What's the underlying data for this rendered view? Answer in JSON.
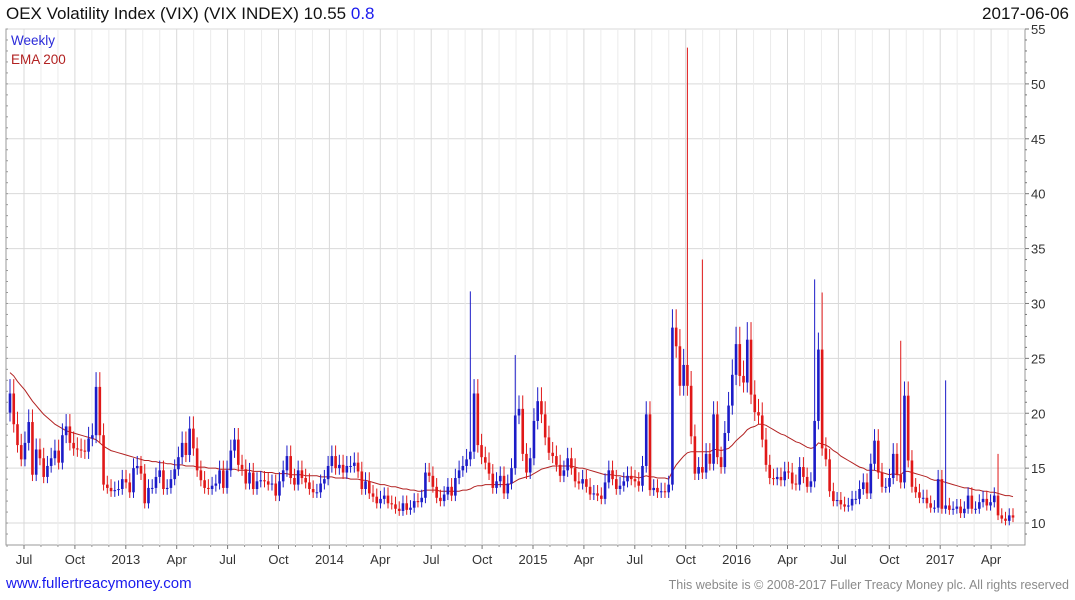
{
  "header": {
    "title": "OEX Volatility Index (VIX) (VIX INDEX) 10.55",
    "change": "0.8",
    "date": "2017-06-06"
  },
  "footer": {
    "link": "www.fullertreacymoney.com",
    "copyright": "This website is © 2008-2017 Fuller Treacy Money plc. All rights reserved"
  },
  "legend": [
    {
      "label": "Weekly",
      "color": "#2b2bd9"
    },
    {
      "label": "EMA 200",
      "color": "#b22222"
    }
  ],
  "colors": {
    "up": "#1c1cc8",
    "down": "#e01818",
    "ema": "#b22222",
    "grid": "#d9d9d9"
  },
  "chart_data": {
    "type": "candlestick",
    "title": "OEX Volatility Index (VIX) (VIX INDEX)",
    "frequency": "Weekly",
    "ylim": [
      8,
      55
    ],
    "yticks": [
      10,
      15,
      20,
      25,
      30,
      35,
      40,
      45,
      50,
      55
    ],
    "x_tick_labels": [
      "Jul",
      "Oct",
      "2013",
      "Apr",
      "Jul",
      "Oct",
      "2014",
      "Apr",
      "Jul",
      "Oct",
      "2015",
      "Apr",
      "Jul",
      "Oct",
      "2016",
      "Apr",
      "Jul",
      "Oct",
      "2017",
      "Apr"
    ],
    "grid": true,
    "legend_position": "top-left",
    "close": [
      21.8,
      19.0,
      17.1,
      15.8,
      17.3,
      19.2,
      14.4,
      16.7,
      15.9,
      14.2,
      15.2,
      15.9,
      16.6,
      15.5,
      18.0,
      18.8,
      17.3,
      16.8,
      16.7,
      16.6,
      16.5,
      17.7,
      18.0,
      22.4,
      18.0,
      13.5,
      13.2,
      12.9,
      13.0,
      13.1,
      14.0,
      13.7,
      12.8,
      15.0,
      15.2,
      14.5,
      11.8,
      13.2,
      13.2,
      14.2,
      14.8,
      13.1,
      13.2,
      14.0,
      14.9,
      16.0,
      17.3,
      16.2,
      18.6,
      16.8,
      14.8,
      13.9,
      13.2,
      13.1,
      13.4,
      13.6,
      14.8,
      13.2,
      14.8,
      16.6,
      17.6,
      15.3,
      14.9,
      13.6,
      14.6,
      13.1,
      13.8,
      13.9,
      13.8,
      13.5,
      13.6,
      12.5,
      13.8,
      14.8,
      16.1,
      14.1,
      13.5,
      14.8,
      14.1,
      13.7,
      13.1,
      12.8,
      12.8,
      13.6,
      14.0,
      15.2,
      16.1,
      15.0,
      15.3,
      14.6,
      15.2,
      15.2,
      15.5,
      14.7,
      13.1,
      13.8,
      12.7,
      12.4,
      11.8,
      12.2,
      12.5,
      11.8,
      11.7,
      11.3,
      11.1,
      11.8,
      11.2,
      11.4,
      12.0,
      11.9,
      12.3,
      14.6,
      14.3,
      13.3,
      12.3,
      12.0,
      12.6,
      13.3,
      12.5,
      14.1,
      14.8,
      15.2,
      15.8,
      16.5,
      21.8,
      17.1,
      16.0,
      15.5,
      14.5,
      13.2,
      13.8,
      14.3,
      12.7,
      13.6,
      15.0,
      19.8,
      20.4,
      16.3,
      14.6,
      15.9,
      19.3,
      21.1,
      19.9,
      17.8,
      16.4,
      16.1,
      15.3,
      14.3,
      14.8,
      15.9,
      15.0,
      13.8,
      13.6,
      14.0,
      13.3,
      12.6,
      12.7,
      12.5,
      12.2,
      13.7,
      14.8,
      14.0,
      13.1,
      13.4,
      13.8,
      14.3,
      14.0,
      13.8,
      13.4,
      15.2,
      19.9,
      13.0,
      13.2,
      12.8,
      12.9,
      12.8,
      13.5,
      27.8,
      26.1,
      22.5,
      24.4,
      22.5,
      17.9,
      14.5,
      15.1,
      14.6,
      16.3,
      15.4,
      19.9,
      16.0,
      15.1,
      18.2,
      20.7,
      23.5,
      26.3,
      23.4,
      22.8,
      26.7,
      21.7,
      20.1,
      19.8,
      17.6,
      15.3,
      14.1,
      14.0,
      14.2,
      13.9,
      14.7,
      14.6,
      13.6,
      13.5,
      15.1,
      14.2,
      13.3,
      13.8,
      19.3,
      25.8,
      16.8,
      15.8,
      12.9,
      12.0,
      12.1,
      11.7,
      11.5,
      11.6,
      12.2,
      12.2,
      13.1,
      13.7,
      12.7,
      15.4,
      17.5,
      14.6,
      13.3,
      13.3,
      14.1,
      16.3,
      14.4,
      13.7,
      21.6,
      15.7,
      13.3,
      12.8,
      12.3,
      12.3,
      11.8,
      11.4,
      11.4,
      14.0,
      11.3,
      11.6,
      11.2,
      11.3,
      11.5,
      10.9,
      11.3,
      12.5,
      11.3,
      11.3,
      11.9,
      12.2,
      11.6,
      11.9,
      12.5,
      10.7,
      10.4,
      10.2,
      10.7,
      10.5
    ],
    "ema_200": [
      23.7,
      23.4,
      22.9,
      22.5,
      22.1,
      21.6,
      21.1,
      20.7,
      20.3,
      19.9,
      19.6,
      19.3,
      19.0,
      18.8,
      18.6,
      18.4,
      18.3,
      18.2,
      18.1,
      18.0,
      17.9,
      17.8,
      17.7,
      17.6,
      17.3,
      17.0,
      16.8,
      16.6,
      16.5,
      16.4,
      16.3,
      16.2,
      16.1,
      16.0,
      15.9,
      15.8,
      15.7,
      15.7,
      15.6,
      15.6,
      15.5,
      15.5,
      15.4,
      15.4,
      15.3,
      15.3,
      15.3,
      15.2,
      15.2,
      15.2,
      15.1,
      15.1,
      15.1,
      15.0,
      15.0,
      15.0,
      14.9,
      14.9,
      14.9,
      14.9,
      14.9,
      14.8,
      14.8,
      14.8,
      14.8,
      14.7,
      14.7,
      14.7,
      14.6,
      14.6,
      14.6,
      14.5,
      14.5,
      14.5,
      14.5,
      14.4,
      14.4,
      14.4,
      14.4,
      14.3,
      14.3,
      14.3,
      14.3,
      14.2,
      14.2,
      14.2,
      14.2,
      14.1,
      14.1,
      14.1,
      14.1,
      14.0,
      14.0,
      14.0,
      13.9,
      13.9,
      13.8,
      13.7,
      13.6,
      13.5,
      13.5,
      13.4,
      13.3,
      13.3,
      13.2,
      13.1,
      13.1,
      13.0,
      13.0,
      12.9,
      12.9,
      13.0,
      13.0,
      13.0,
      13.0,
      12.9,
      12.9,
      12.9,
      12.9,
      12.9,
      12.9,
      13.0,
      13.0,
      13.1,
      13.3,
      13.4,
      13.4,
      13.5,
      13.5,
      13.5,
      13.5,
      13.5,
      13.5,
      13.5,
      13.6,
      13.8,
      14.0,
      14.1,
      14.2,
      14.3,
      14.5,
      14.7,
      14.9,
      15.0,
      15.1,
      15.2,
      15.2,
      15.2,
      15.2,
      15.2,
      15.2,
      15.1,
      15.0,
      15.0,
      14.9,
      14.8,
      14.7,
      14.6,
      14.5,
      14.4,
      14.4,
      14.4,
      14.3,
      14.3,
      14.2,
      14.2,
      14.2,
      14.2,
      14.1,
      14.2,
      14.3,
      14.2,
      14.2,
      14.1,
      14.1,
      14.1,
      14.0,
      14.7,
      15.3,
      15.7,
      16.1,
      16.4,
      16.5,
      16.5,
      16.5,
      16.5,
      16.5,
      16.5,
      16.7,
      16.7,
      16.6,
      16.7,
      16.8,
      17.1,
      17.5,
      17.8,
      18.1,
      18.5,
      18.7,
      18.8,
      19.0,
      19.0,
      18.9,
      18.7,
      18.5,
      18.3,
      18.1,
      18.0,
      17.8,
      17.6,
      17.4,
      17.3,
      17.1,
      16.9,
      16.8,
      16.9,
      17.3,
      17.2,
      17.1,
      16.9,
      16.6,
      16.4,
      16.1,
      15.9,
      15.7,
      15.5,
      15.3,
      15.1,
      15.0,
      14.8,
      14.8,
      14.8,
      14.7,
      14.6,
      14.5,
      14.4,
      14.5,
      14.4,
      14.4,
      14.7,
      14.7,
      14.6,
      14.5,
      14.4,
      14.3,
      14.2,
      14.0,
      13.9,
      13.9,
      13.8,
      13.7,
      13.6,
      13.5,
      13.4,
      13.3,
      13.2,
      13.2,
      13.1,
      13.0,
      13.0,
      12.9,
      12.9,
      12.8,
      12.8,
      12.7,
      12.6,
      12.5,
      12.5,
      12.4
    ]
  }
}
